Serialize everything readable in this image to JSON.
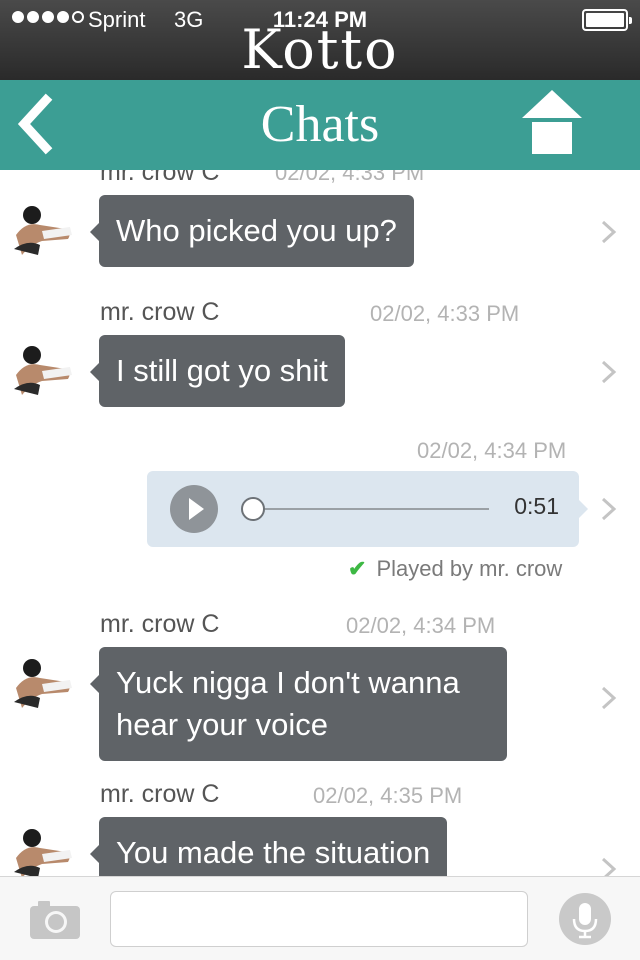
{
  "status_bar": {
    "carrier": "Sprint",
    "network": "3G",
    "time": "11:24 PM",
    "signal_bars_filled": 4,
    "signal_bars_total": 5
  },
  "brand": {
    "title": "Kotto"
  },
  "nav": {
    "title": "Chats",
    "back_icon": "back-chevron-icon",
    "home_icon": "home-icon"
  },
  "messages": [
    {
      "sender": "mr. crow C",
      "time": "02/02, 4:33 PM",
      "text": "Who picked you up?"
    },
    {
      "sender": "mr. crow C",
      "time": "02/02, 4:33 PM",
      "text": "I still got yo shit"
    },
    {
      "time": "02/02, 4:34 PM",
      "audio_duration": "0:51",
      "audio_progress": 0,
      "played_by": "Played by mr. crow"
    },
    {
      "sender": "mr. crow C",
      "time": "02/02, 4:34 PM",
      "text": "Yuck nigga I don't wanna hear your voice"
    },
    {
      "sender": "mr. crow C",
      "time": "02/02, 4:35 PM",
      "text": "You made the situation"
    }
  ],
  "input_bar": {
    "camera_icon": "camera-icon",
    "mic_icon": "microphone-icon"
  },
  "colors": {
    "nav_bg": "#3c9e94",
    "incoming_bubble": "#5f6367",
    "audio_bubble": "#dce6ef",
    "played_check": "#3db844"
  }
}
